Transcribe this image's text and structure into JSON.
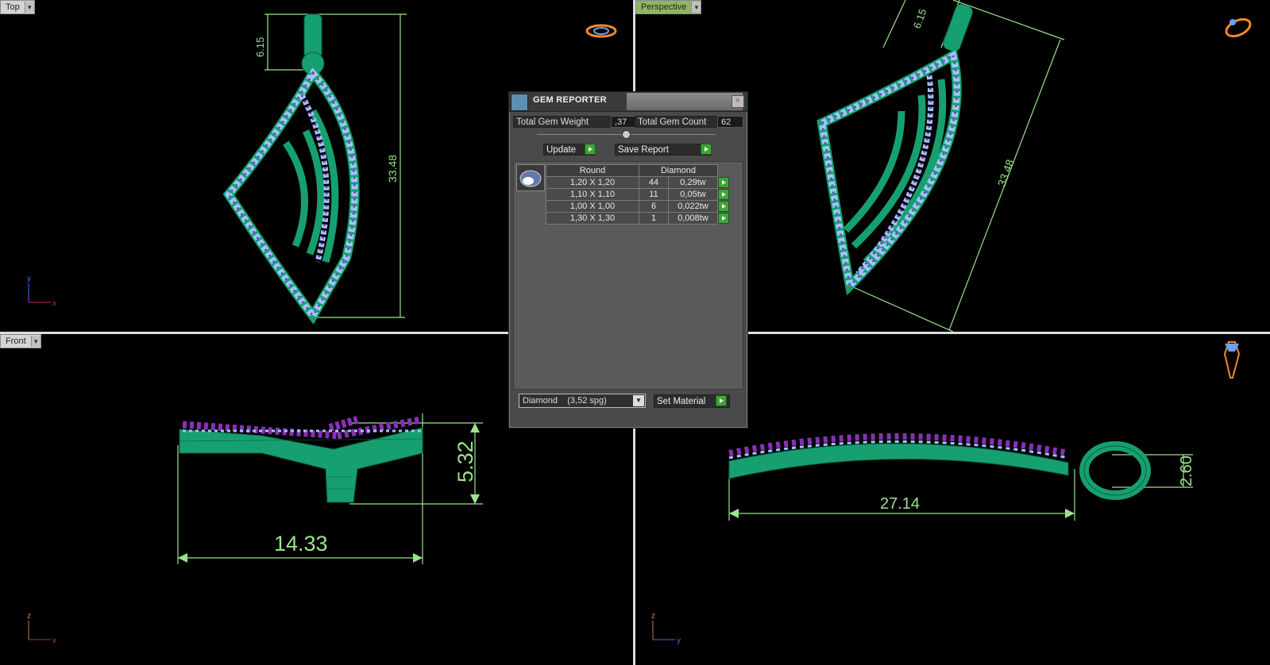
{
  "viewports": {
    "top": {
      "label": "Top",
      "dims": [
        "6.15",
        "33.48"
      ],
      "axis": {
        "v": "y",
        "h": "x"
      }
    },
    "perspective": {
      "label": "Perspective",
      "dims": [
        "6.15",
        "33.48"
      ]
    },
    "front": {
      "label": "Front",
      "dims": [
        "5.32",
        "14.33"
      ],
      "axis": {
        "v": "z",
        "h": "x"
      }
    },
    "right": {
      "dims": [
        "2.60",
        "27.14"
      ],
      "axis": {
        "v": "z",
        "h": "y"
      }
    }
  },
  "gem_reporter": {
    "title": "GEM REPORTER",
    "total_weight_label": "Total Gem Weight",
    "total_weight_value": ",37",
    "total_count_label": "Total Gem Count",
    "total_count_value": "62",
    "update_label": "Update",
    "save_report_label": "Save Report",
    "table": {
      "shape": "Round",
      "material": "Diamond",
      "rows": [
        {
          "size": "1,20 X 1,20",
          "count": "44",
          "weight": "0,29tw"
        },
        {
          "size": "1,10 X 1,10",
          "count": "11",
          "weight": "0,05tw"
        },
        {
          "size": "1,00 X 1,00",
          "count": "6",
          "weight": "0,022tw"
        },
        {
          "size": "1,30 X 1,30",
          "count": "1",
          "weight": "0,008tw"
        }
      ]
    },
    "material_select": "Diamond    (3,52 spg)",
    "set_material_label": "Set Material"
  },
  "colors": {
    "metal": "#16a070",
    "stone": "#9fc6ff",
    "prong": "#8a2fb8",
    "dimension": "#9be38c"
  }
}
